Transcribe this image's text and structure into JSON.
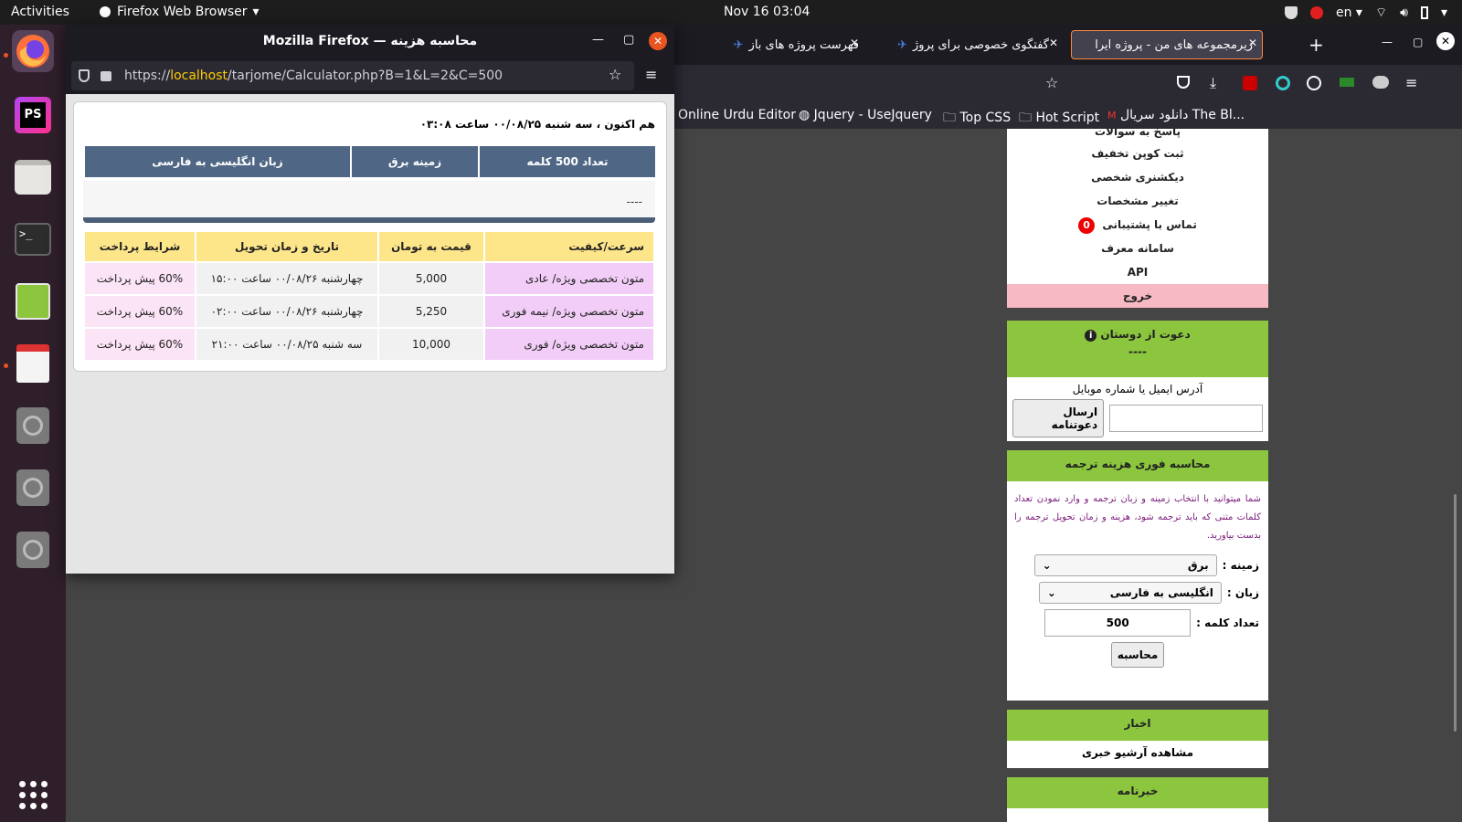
{
  "topbar": {
    "activities": "Activities",
    "app_name": "Firefox Web Browser",
    "clock": "Nov 16  03:04",
    "lang": "en"
  },
  "dock": {
    "items": [
      "firefox-icon",
      "phpstorm-icon",
      "files-icon",
      "terminal-icon",
      "text-editor-icon",
      "document-viewer-icon",
      "disk-icon",
      "disk-icon",
      "disk-icon",
      "app-grid-icon"
    ],
    "ps_label": "PS"
  },
  "bg_browser": {
    "tabs": [
      {
        "label": "فهرست پروژه های باز"
      },
      {
        "label": "گفتگوی خصوصی برای پروژ"
      },
      {
        "label": "زیرمجموعه های من - پروژه ایرا"
      }
    ],
    "bookmarks": [
      "Online Urdu Editor",
      "Jquery - UseJquery",
      "Top CSS",
      "Hot Script",
      "دانلود سریال The Bl..."
    ]
  },
  "sidebar": {
    "menu": [
      "پاسخ به سوالات",
      "ثبت کوپن تخفیف",
      "دیکشنری شخصی",
      "تغییر مشخصات",
      "تماس با پشتیبانی",
      "سامانه معرف",
      "API"
    ],
    "support_badge": "0",
    "exit": "خروج",
    "invite": {
      "title": "دعوت از دوستان",
      "dashes": "----",
      "label": "آدرس ایمیل یا شماره موبایل",
      "send_button": "ارسال دعوتنامه"
    },
    "calc": {
      "title": "محاسبه فوری هزینه ترجمه",
      "desc": "شما میتوانید با انتخاب زمینه و زبان ترجمه و وارد نمودن تعداد کلمات متنی که باید ترجمه شود، هزینه و زمان تحویل ترجمه را بدست بیاورید.",
      "field_label": "زمینه :",
      "field_value": "برق",
      "lang_label": "زبان :",
      "lang_value": "انگلیسی به فارسی",
      "count_label": "تعداد کلمه :",
      "count_value": "500",
      "calc_button": "محاسبه"
    },
    "news": {
      "title": "اخبار",
      "archive": "مشاهده آرشیو خبری"
    },
    "newsletter": {
      "title": "خبرنامه"
    }
  },
  "popup": {
    "title": "محاسبه هزینه — Mozilla Firefox",
    "url_scheme": "https://",
    "url_host": "localhost",
    "url_path": "/tarjome/Calculator.php?B=1&L=2&C=500",
    "now": "هم اکنون ، سه شنبه ۰۰/۰۸/۲۵ ساعت ۰۳:۰۸",
    "summary": [
      "تعداد 500 کلمه",
      "زمینه برق",
      "زبان انگلیسی به فارسی"
    ],
    "dash": "----",
    "table": {
      "headers": [
        "سرعت/کیفیت",
        "قیمت به تومان",
        "تاریخ و زمان تحویل",
        "شرایط پرداخت"
      ],
      "rows": [
        [
          "متون تخصصی ویژه/ عادی",
          "5,000",
          "چهارشنبه ۰۰/۰۸/۲۶ ساعت ۱۵:۰۰",
          "60% پیش پرداخت"
        ],
        [
          "متون تخصصی ویژه/ نیمه فوری",
          "5,250",
          "چهارشنبه ۰۰/۰۸/۲۶ ساعت ۰۲:۰۰",
          "60% پیش پرداخت"
        ],
        [
          "متون تخصصی ویژه/ فوری",
          "10,000",
          "سه شنبه ۰۰/۰۸/۲۵ ساعت ۲۱:۰۰",
          "60% پیش پرداخت"
        ]
      ]
    }
  }
}
